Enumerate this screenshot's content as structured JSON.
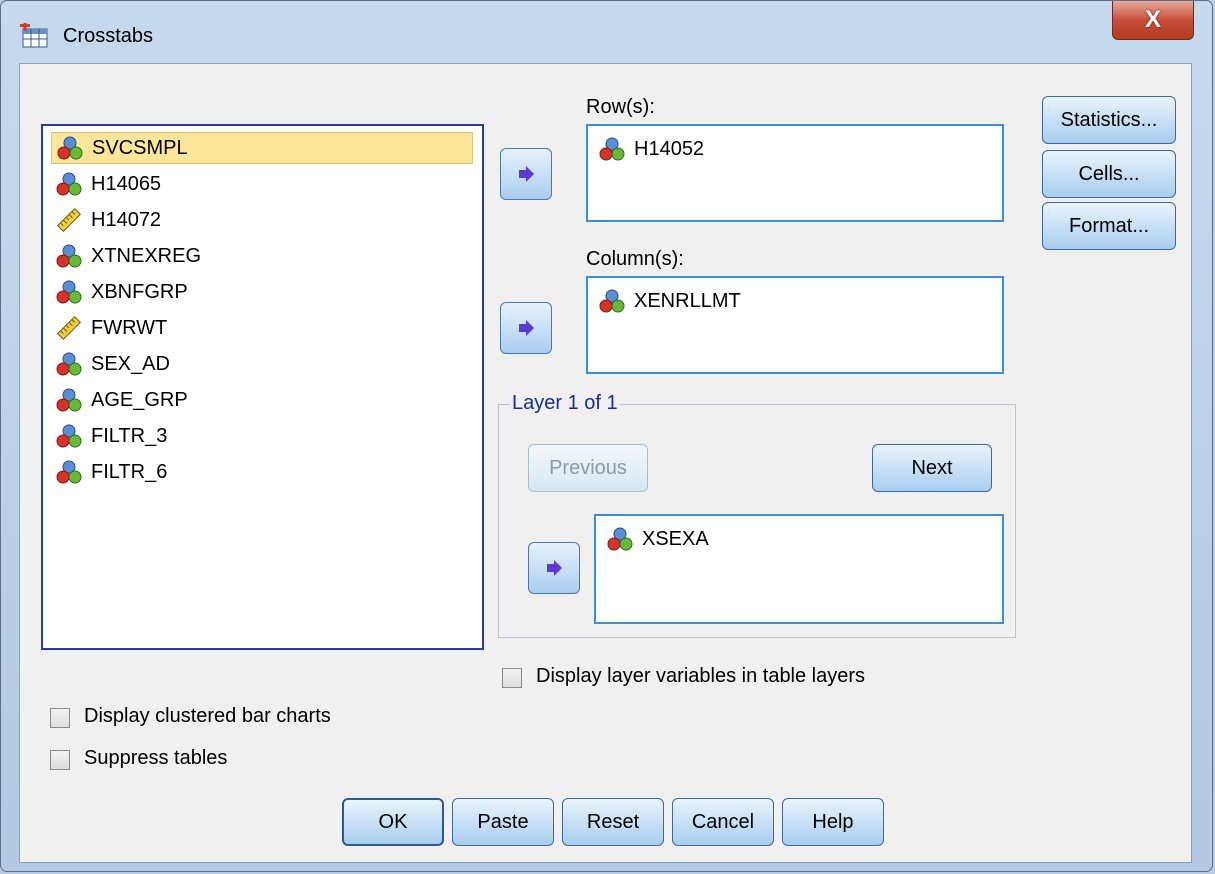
{
  "window": {
    "title": "Crosstabs",
    "close_glyph": "X"
  },
  "variables": [
    {
      "name": "SVCSMPL",
      "icon": "nominal-icon",
      "selected": true
    },
    {
      "name": "H14065",
      "icon": "nominal-icon"
    },
    {
      "name": "H14072",
      "icon": "scale-icon"
    },
    {
      "name": "XTNEXREG",
      "icon": "nominal-icon"
    },
    {
      "name": "XBNFGRP",
      "icon": "nominal-icon"
    },
    {
      "name": "FWRWT",
      "icon": "scale-icon"
    },
    {
      "name": "SEX_AD",
      "icon": "nominal-icon"
    },
    {
      "name": "AGE_GRP",
      "icon": "nominal-icon"
    },
    {
      "name": "FILTR_3",
      "icon": "nominal-icon"
    },
    {
      "name": "FILTR_6",
      "icon": "nominal-icon"
    }
  ],
  "rows": {
    "label": "Row(s):",
    "item": "H14052"
  },
  "columns": {
    "label": "Column(s):",
    "item": "XENRLLMT"
  },
  "layer": {
    "legend": "Layer 1 of 1",
    "previous_label": "Previous",
    "next_label": "Next",
    "item": "XSEXA"
  },
  "side_buttons": {
    "statistics": "Statistics...",
    "cells": "Cells...",
    "format": "Format..."
  },
  "checkboxes": {
    "layer_vars": "Display layer variables in table layers",
    "clustered": "Display clustered bar charts",
    "suppress": "Suppress tables"
  },
  "buttons": {
    "ok": "OK",
    "paste": "Paste",
    "reset": "Reset",
    "cancel": "Cancel",
    "help": "Help"
  },
  "colors": {
    "selection": "#fce69a",
    "field_border": "#3a8fd6",
    "arrow": "#5a3ad0",
    "close": "#c8503a"
  }
}
